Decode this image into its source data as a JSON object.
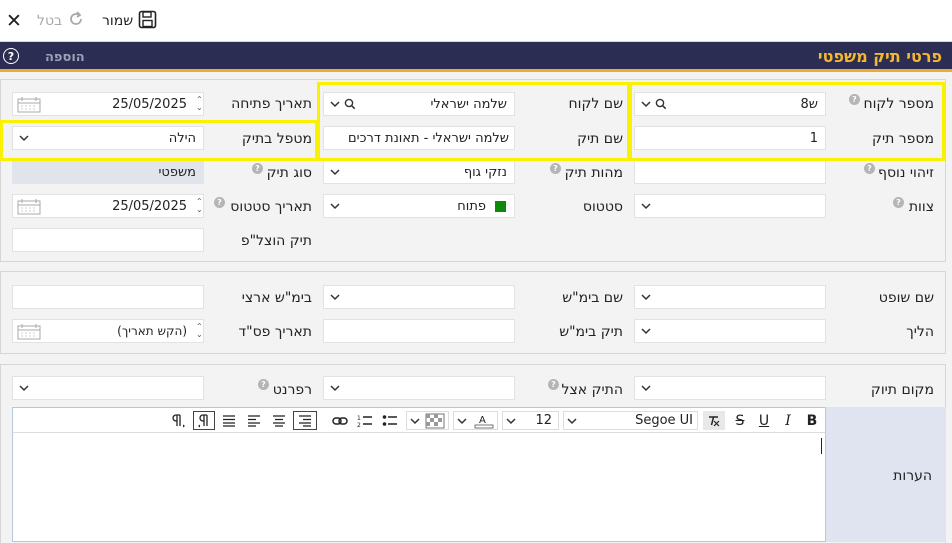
{
  "toolbar": {
    "save_label": "שמור",
    "cancel_label": "בטל"
  },
  "header": {
    "title": "פרטי תיק משפטי",
    "add_tab": "הוספה",
    "help_glyph": "?"
  },
  "main": {
    "client_number": {
      "label": "מספר לקוח",
      "value": "ש8"
    },
    "client_name": {
      "label": "שם לקוח",
      "value": "שלמה ישראלי"
    },
    "open_date": {
      "label": "תאריך פתיחה",
      "value": "25/05/2025"
    },
    "case_number": {
      "label": "מספר תיק",
      "value": "1"
    },
    "case_name": {
      "label": "שם תיק",
      "value": "שלמה ישראלי - תאונת דרכים"
    },
    "case_handler": {
      "label": "מטפל בתיק",
      "value": "הילה"
    },
    "extra_id": {
      "label": "זיהוי נוסף",
      "value": ""
    },
    "case_nature": {
      "label": "מהות תיק",
      "value": "נזקי גוף"
    },
    "case_type": {
      "label": "סוג תיק",
      "value": "משפטי"
    },
    "team": {
      "label": "צוות",
      "value": ""
    },
    "status": {
      "label": "סטטוס",
      "value": "פתוח",
      "color": "#0c8a0c"
    },
    "status_date": {
      "label": "תאריך סטטוס",
      "value": "25/05/2025"
    },
    "execution_file": {
      "label": "תיק הוצל\"פ",
      "value": ""
    }
  },
  "court": {
    "judge_name": {
      "label": "שם שופט",
      "value": ""
    },
    "court_name": {
      "label": "שם בימ\"ש",
      "value": ""
    },
    "national_court": {
      "label": "בימ\"ש ארצי",
      "value": ""
    },
    "procedure": {
      "label": "הליך",
      "value": ""
    },
    "court_file": {
      "label": "תיק בימ\"ש",
      "value": ""
    },
    "verdict_date": {
      "label": "תאריך פס\"ד",
      "value": "(הקש תאריך)"
    }
  },
  "filing": {
    "location": {
      "label": "מקום תיוק",
      "value": ""
    },
    "file_holder": {
      "label": "התיק אצל",
      "value": ""
    },
    "referent": {
      "label": "רפרנט",
      "value": ""
    },
    "notes_label": "הערות"
  },
  "editor": {
    "font_name": "Segoe UI",
    "font_size": "12"
  },
  "colors": {
    "title_bar": "#2b2d52",
    "accent": "#f5b730",
    "highlight": "#f8f200"
  }
}
